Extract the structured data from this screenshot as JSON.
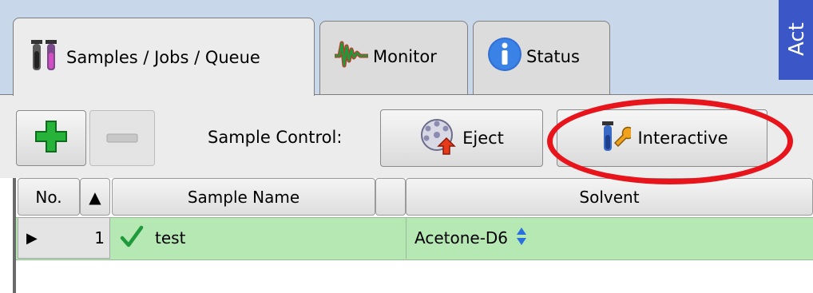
{
  "tabs": [
    {
      "label": "Samples / Jobs / Queue",
      "icon": "test-tubes-icon",
      "active": true
    },
    {
      "label": "Monitor",
      "icon": "waveform-icon",
      "active": false
    },
    {
      "label": "Status",
      "icon": "info-icon",
      "active": false
    }
  ],
  "side_panel": {
    "label": "Act"
  },
  "toolbar": {
    "add_icon": "plus-icon",
    "remove_icon": "minus-icon",
    "sample_control_label": "Sample Control:",
    "eject_label": "Eject",
    "interactive_label": "Interactive"
  },
  "table": {
    "columns": {
      "no": "No.",
      "sort": "▲",
      "sample_name": "Sample Name",
      "solvent": "Solvent"
    },
    "rows": [
      {
        "no": "1",
        "status": "checkmark-icon",
        "sample_name": "test",
        "solvent": "Acetone-D6"
      }
    ]
  },
  "colors": {
    "annotation": "#e8141b",
    "row_highlight": "#b5e8b2",
    "side_panel": "#3b57c7",
    "tabstrip": "#c8d7ea"
  }
}
